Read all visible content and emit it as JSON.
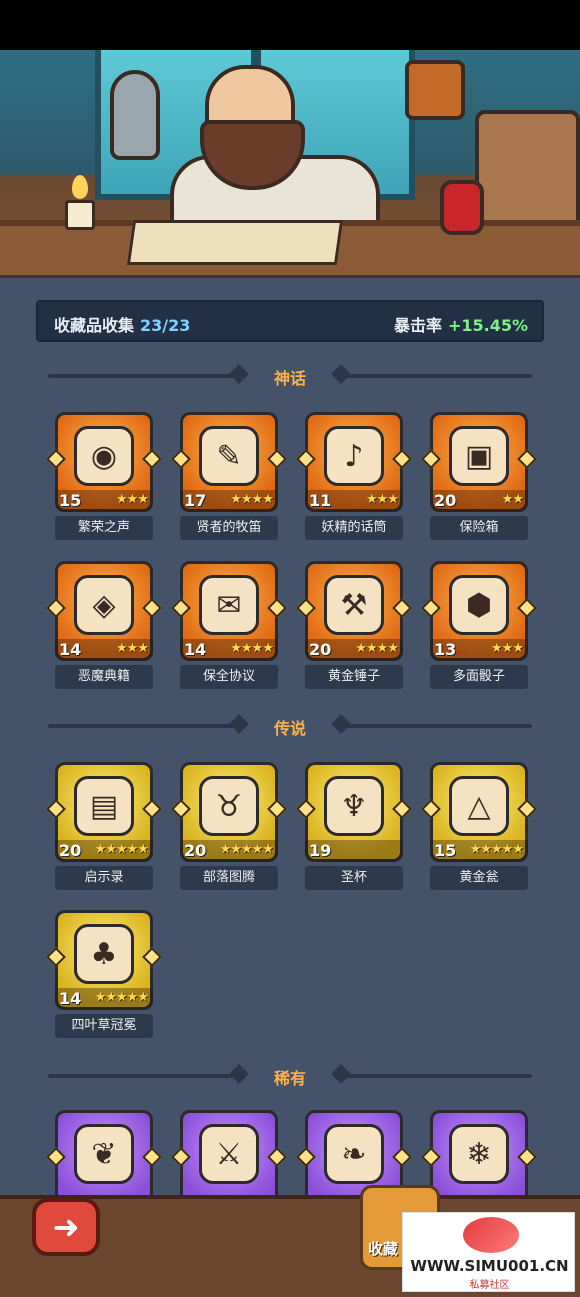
{
  "header": {
    "title": "收藏品收集",
    "progress": "23/23",
    "bonus_label": "暴击率",
    "bonus_value": "+15.45%"
  },
  "sections": [
    {
      "title": "神话",
      "items": [
        {
          "name": "繁荣之声",
          "count": "15",
          "stars": 3,
          "icon": "ghost-orb-icon"
        },
        {
          "name": "贤者的牧笛",
          "count": "17",
          "stars": 4,
          "icon": "flute-icon"
        },
        {
          "name": "妖精的话筒",
          "count": "11",
          "stars": 3,
          "icon": "fairy-microphone-icon"
        },
        {
          "name": "保险箱",
          "count": "20",
          "stars": 2,
          "icon": "treasure-chest-icon"
        },
        {
          "name": "恶魔典籍",
          "count": "14",
          "stars": 3,
          "icon": "demon-book-icon"
        },
        {
          "name": "保全协议",
          "count": "14",
          "stars": 4,
          "icon": "contract-icon"
        },
        {
          "name": "黄金锤子",
          "count": "20",
          "stars": 4,
          "icon": "golden-hammer-icon"
        },
        {
          "name": "多面骰子",
          "count": "13",
          "stars": 3,
          "icon": "dice-icon"
        }
      ]
    },
    {
      "title": "传说",
      "items": [
        {
          "name": "启示录",
          "count": "20",
          "stars": 5,
          "icon": "open-book-icon"
        },
        {
          "name": "部落图腾",
          "count": "20",
          "stars": 5,
          "icon": "totem-icon"
        },
        {
          "name": "圣杯",
          "count": "19",
          "stars": 0,
          "icon": "grail-icon"
        },
        {
          "name": "黄金瓮",
          "count": "15",
          "stars": 5,
          "icon": "golden-urn-icon"
        },
        {
          "name": "四叶草冠冕",
          "count": "14",
          "stars": 5,
          "icon": "clover-crown-icon"
        }
      ]
    },
    {
      "title": "稀有",
      "items": [
        {
          "name": "",
          "count": "",
          "stars": 0,
          "icon": "vine-icon"
        },
        {
          "name": "",
          "count": "",
          "stars": 0,
          "icon": "axe-icon"
        },
        {
          "name": "",
          "count": "",
          "stars": 0,
          "icon": "feather-icon"
        },
        {
          "name": "",
          "count": "",
          "stars": 0,
          "icon": "ice-sword-icon"
        }
      ]
    }
  ],
  "footer": {
    "back_icon": "arrow-left-icon",
    "collection_label": "收藏"
  },
  "watermark": {
    "url": "WWW.SIMU001.CN",
    "sub": "私募社区"
  },
  "colors": {
    "myth": "#e8781c",
    "legend": "#e2c02a",
    "rare": "#9a5de6",
    "panel": "#44536a"
  }
}
